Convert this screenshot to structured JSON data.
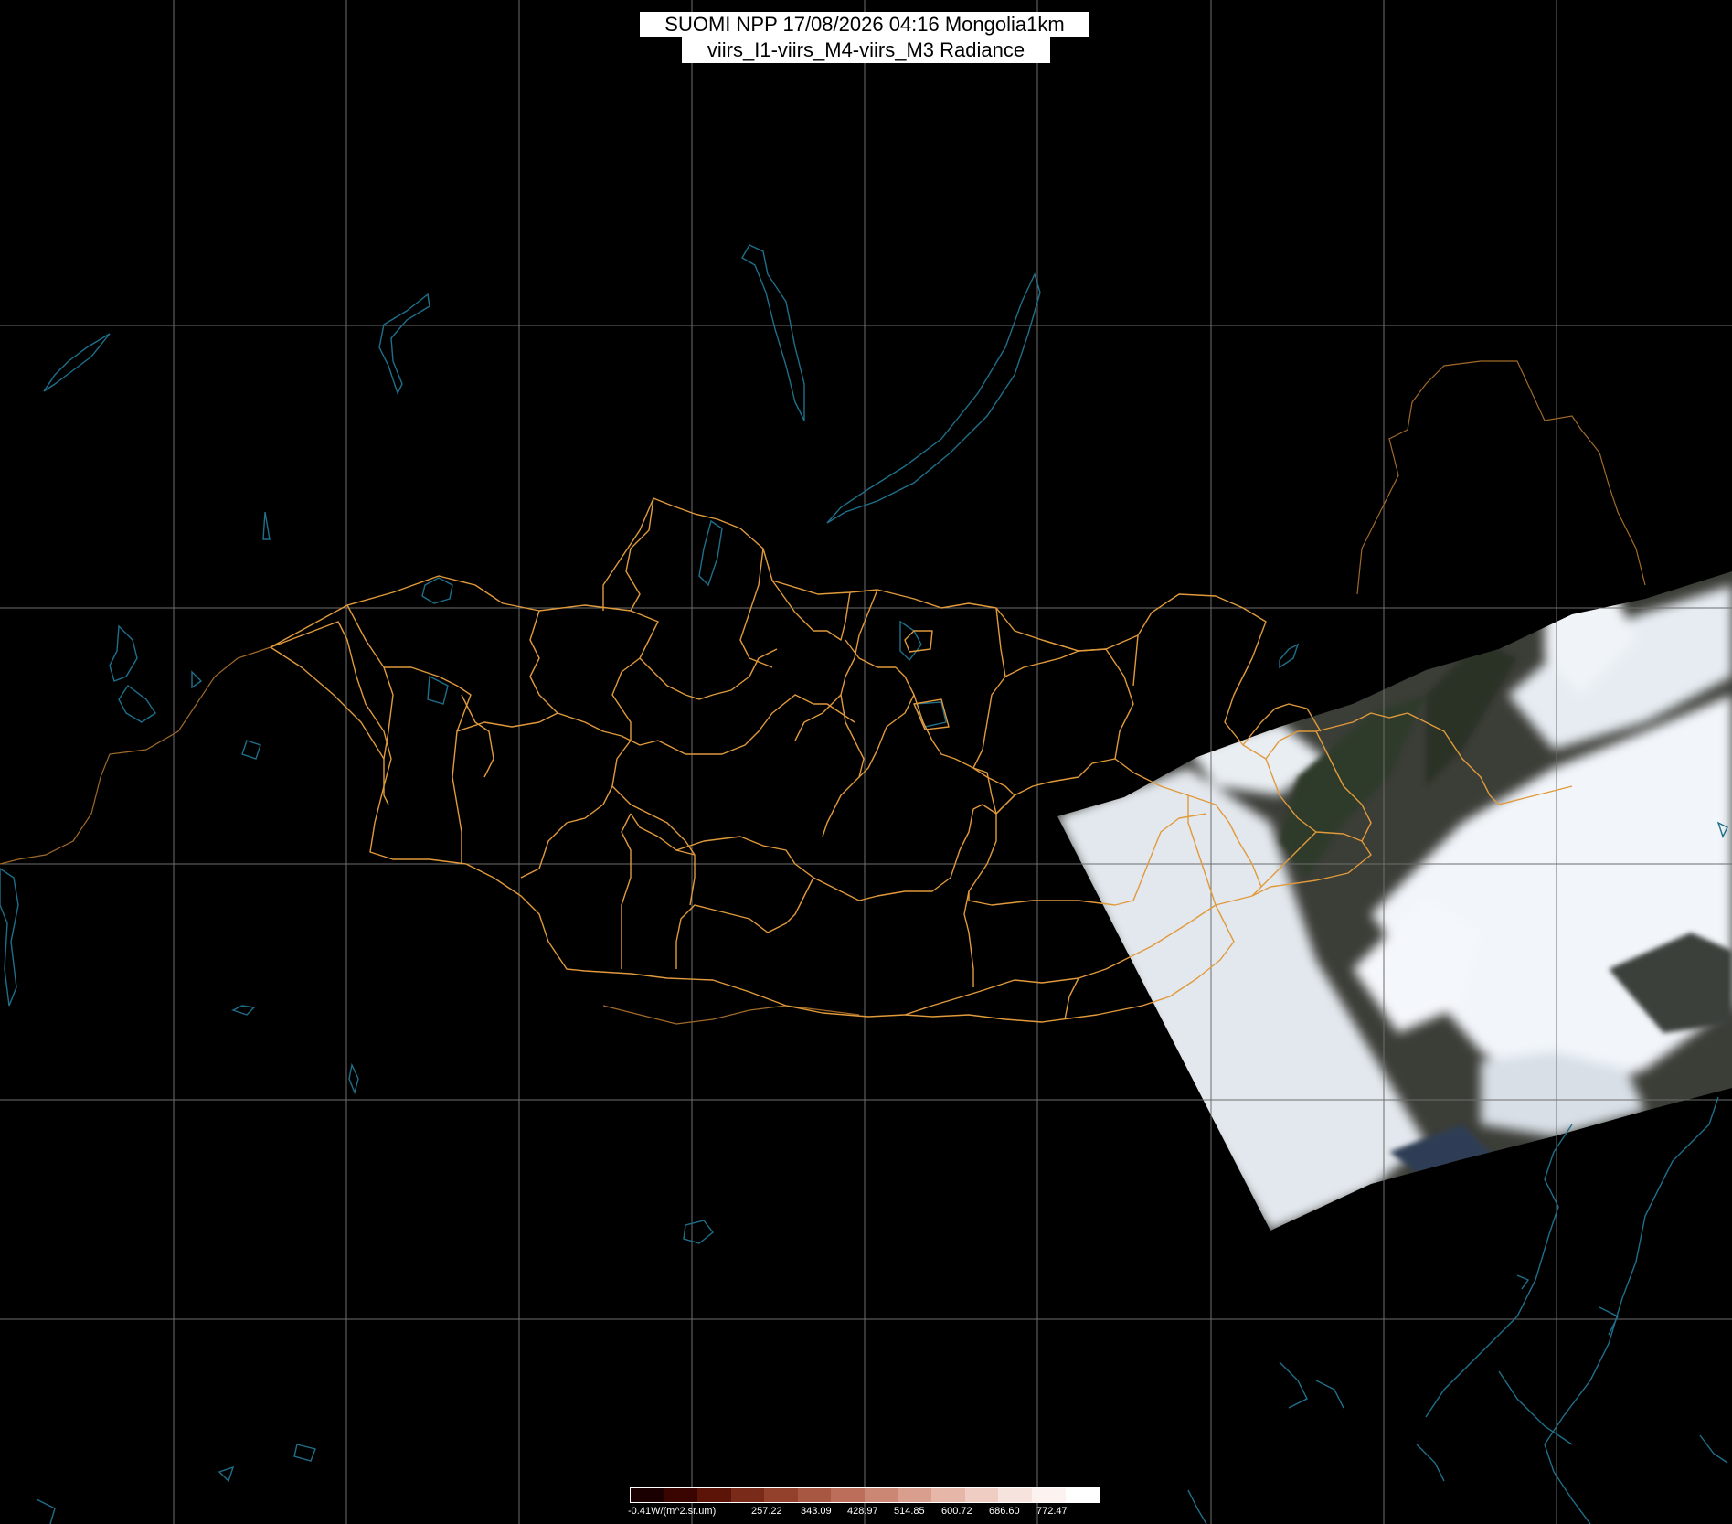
{
  "title": {
    "line1": "SUOMI NPP 17/08/2026 04:16 Mongolia1km",
    "line2": "viirs_I1-viirs_M4-viirs_M3 Radiance"
  },
  "colors": {
    "background": "#000000",
    "graticule": "#6e6e6e",
    "coastline": "#1f6f8a",
    "admin_border": "#e09a3c",
    "country_border": "#a06a2a"
  },
  "colorbar": {
    "unit_label": "-0.41W/(m^2.sr.um)",
    "ticks": [
      "257.22",
      "343.09",
      "428.97",
      "514.85",
      "600.72",
      "686.60",
      "772.47"
    ],
    "colors": [
      "#1a0000",
      "#3a0500",
      "#5c1408",
      "#7a2a18",
      "#93402c",
      "#a85742",
      "#bc6e5a",
      "#cc8674",
      "#da9e8e",
      "#e6b6a9",
      "#efcdc3",
      "#f7e3dd",
      "#fcf2ef",
      "#ffffff"
    ]
  }
}
